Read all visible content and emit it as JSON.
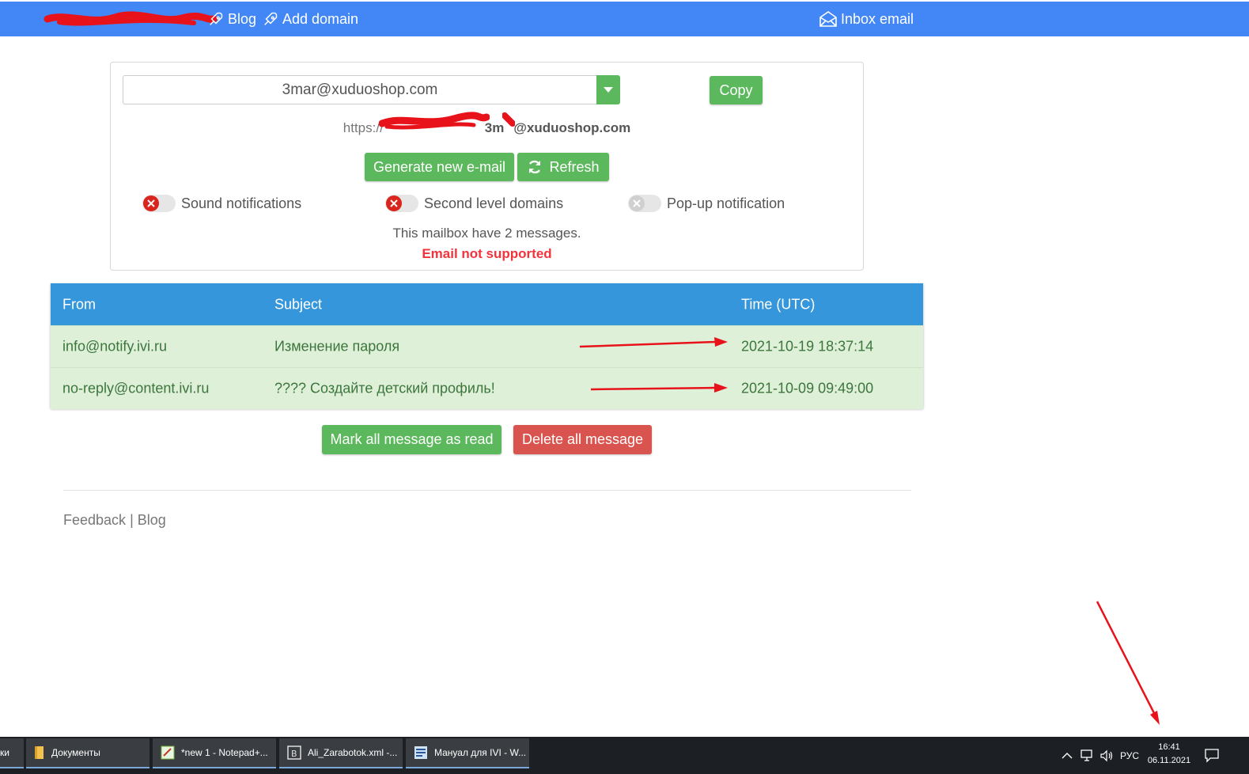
{
  "navbar": {
    "blog_label": "Blog",
    "add_domain_label": "Add domain",
    "inbox_label": "Inbox email",
    "bg_color": "#4287f5"
  },
  "mailbox": {
    "selected_email": "3mar@xuduoshop.com",
    "copy_label": "Copy",
    "url_prefix": "https://",
    "url_suffix": "3m",
    "url_domain": "@xuduoshop.com",
    "generate_label": "Generate new e-mail",
    "refresh_label": "Refresh",
    "toggles": [
      {
        "label": "Sound notifications",
        "state": "off-red"
      },
      {
        "label": "Second level domains",
        "state": "off-red"
      },
      {
        "label": "Pop-up notification",
        "state": "off-gray"
      }
    ],
    "count_text": "This mailbox have 2 messages.",
    "warning_text": "Email not supported"
  },
  "table": {
    "headers": [
      "From",
      "Subject",
      "Time (UTC)"
    ],
    "rows": [
      {
        "from": "info@notify.ivi.ru",
        "subject": "Изменение пароля",
        "time": "2021-10-19 18:37:14"
      },
      {
        "from": "no-reply@content.ivi.ru",
        "subject": "???? Создайте детский профиль!",
        "time": "2021-10-09 09:49:00"
      }
    ],
    "header_color": "#3596db",
    "row_color": "#dff0d8"
  },
  "actions": {
    "mark_read_label": "Mark all message as read",
    "delete_label": "Delete all message"
  },
  "footer": {
    "feedback_label": "Feedback",
    "separator": "|",
    "blog_label": "Blog"
  },
  "taskbar": {
    "left_partial": "ки",
    "tasks": [
      {
        "label": "Документы",
        "icon": "folder-icon"
      },
      {
        "label": "*new 1 - Notepad+...",
        "icon": "notepad-icon"
      },
      {
        "label": "Ali_Zarabotok.xml -...",
        "icon": "editor-icon"
      },
      {
        "label": "Мануал для IVI - W...",
        "icon": "word-icon"
      }
    ],
    "language": "РУС",
    "time": "16:41",
    "date": "06.11.2021"
  }
}
